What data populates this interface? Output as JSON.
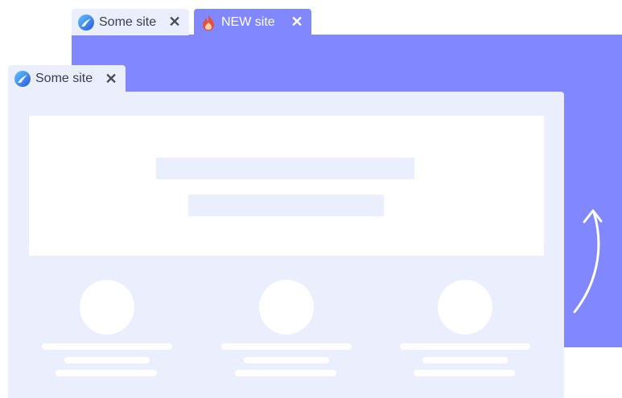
{
  "colors": {
    "accent": "#8187ff",
    "tab_background": "#ebeefc",
    "page_background": "#ebeefc",
    "content_block": "#ffffff"
  },
  "back_window": {
    "tabs": [
      {
        "label": "Some site",
        "icon": "globe-feather-icon",
        "close": "✕"
      },
      {
        "label": "NEW site",
        "icon": "flame-icon",
        "close": "✕",
        "active": true
      }
    ]
  },
  "front_window": {
    "tab": {
      "label": "Some site",
      "icon": "globe-feather-icon",
      "close": "✕"
    }
  },
  "decoration": {
    "arrow_icon": "curved-up-arrow-icon"
  }
}
